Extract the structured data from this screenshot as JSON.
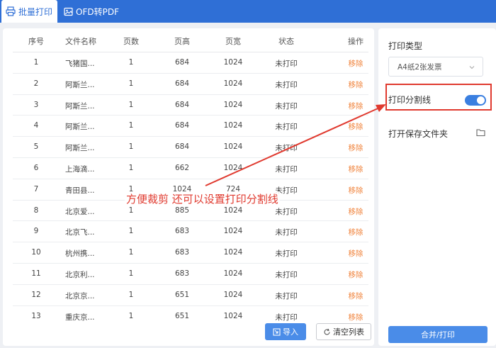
{
  "tabs": [
    {
      "label": "批量打印",
      "active": true,
      "icon": "printer-icon"
    },
    {
      "label": "OFD转PDF",
      "active": false,
      "icon": "image-icon"
    }
  ],
  "table": {
    "columns": [
      "序号",
      "文件名称",
      "页数",
      "页高",
      "页宽",
      "状态",
      "操作"
    ],
    "rows": [
      {
        "idx": "1",
        "name": "飞猪国...",
        "pages": "1",
        "height": "684",
        "width": "1024",
        "status": "未打印",
        "op": "移除"
      },
      {
        "idx": "2",
        "name": "阿斯兰...",
        "pages": "1",
        "height": "684",
        "width": "1024",
        "status": "未打印",
        "op": "移除"
      },
      {
        "idx": "3",
        "name": "阿斯兰...",
        "pages": "1",
        "height": "684",
        "width": "1024",
        "status": "未打印",
        "op": "移除"
      },
      {
        "idx": "4",
        "name": "阿斯兰...",
        "pages": "1",
        "height": "684",
        "width": "1024",
        "status": "未打印",
        "op": "移除"
      },
      {
        "idx": "5",
        "name": "阿斯兰...",
        "pages": "1",
        "height": "684",
        "width": "1024",
        "status": "未打印",
        "op": "移除"
      },
      {
        "idx": "6",
        "name": "上海滴...",
        "pages": "1",
        "height": "662",
        "width": "1024",
        "status": "未打印",
        "op": "移除"
      },
      {
        "idx": "7",
        "name": "青田县...",
        "pages": "1",
        "height": "1024",
        "width": "724",
        "status": "未打印",
        "op": "移除"
      },
      {
        "idx": "8",
        "name": "北京爱...",
        "pages": "1",
        "height": "885",
        "width": "1024",
        "status": "未打印",
        "op": "移除"
      },
      {
        "idx": "9",
        "name": "北京飞...",
        "pages": "1",
        "height": "683",
        "width": "1024",
        "status": "未打印",
        "op": "移除"
      },
      {
        "idx": "10",
        "name": "杭州携...",
        "pages": "1",
        "height": "683",
        "width": "1024",
        "status": "未打印",
        "op": "移除"
      },
      {
        "idx": "11",
        "name": "北京利...",
        "pages": "1",
        "height": "683",
        "width": "1024",
        "status": "未打印",
        "op": "移除"
      },
      {
        "idx": "12",
        "name": "北京京...",
        "pages": "1",
        "height": "651",
        "width": "1024",
        "status": "未打印",
        "op": "移除"
      },
      {
        "idx": "13",
        "name": "重庆京...",
        "pages": "1",
        "height": "651",
        "width": "1024",
        "status": "未打印",
        "op": "移除"
      }
    ]
  },
  "buttons": {
    "import_label": "导入",
    "clear_label": "清空列表",
    "merge_label": "合并/打印"
  },
  "settings": {
    "print_type_title": "打印类型",
    "print_type_value": "A4纸2张发票",
    "split_line_label": "打印分割线",
    "split_line_on": true,
    "open_folder_label": "打开保存文件夹"
  },
  "annotation": {
    "text": "方便裁剪 还可以设置打印分割线"
  },
  "colors": {
    "brand": "#2f6fd6",
    "button": "#4a8ce8",
    "remove": "#f0823a",
    "annotation": "#e03a2f"
  }
}
